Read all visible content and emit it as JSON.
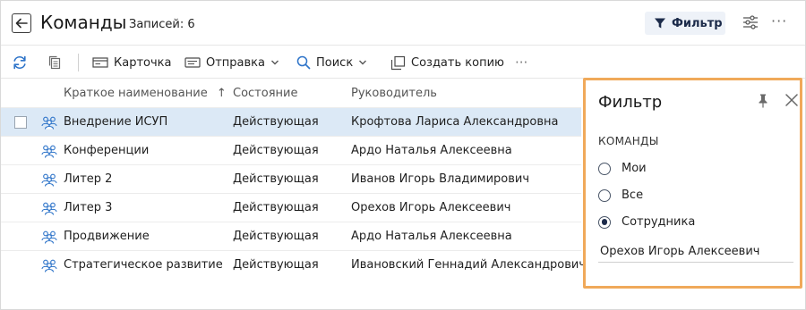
{
  "header": {
    "title": "Команды",
    "records_label": "Записей: 6",
    "filter_button": "Фильтр"
  },
  "toolbar": {
    "card": "Карточка",
    "send": "Отправка",
    "search": "Поиск",
    "create_copy": "Создать копию"
  },
  "table": {
    "columns": [
      "Краткое наименование",
      "Состояние",
      "Руководитель"
    ],
    "sort_indicator": "↑",
    "rows": [
      {
        "name": "Внедрение ИСУП",
        "state": "Действующая",
        "head": "Крофтова Лариса Александровна",
        "selected": true
      },
      {
        "name": "Конференции",
        "state": "Действующая",
        "head": "Ардо Наталья Алексеевна"
      },
      {
        "name": "Литер 2",
        "state": "Действующая",
        "head": "Иванов Игорь Владимирович"
      },
      {
        "name": "Литер 3",
        "state": "Действующая",
        "head": "Орехов Игорь Алексеевич"
      },
      {
        "name": "Продвижение",
        "state": "Действующая",
        "head": "Ардо Наталья Алексеевна"
      },
      {
        "name": "Стратегическое развитие",
        "state": "Действующая",
        "head": "Ивановский Геннадий Александрович"
      }
    ]
  },
  "filter_panel": {
    "title": "Фильтр",
    "section": "КОМАНДЫ",
    "options": [
      "Мои",
      "Все",
      "Сотрудника"
    ],
    "selected_option": "Сотрудника",
    "employee_value": "Орехов Игорь Алексеевич"
  },
  "colors": {
    "accent": "#1c2b4a",
    "selection": "#dce9f6",
    "highlight_border": "#f0a95a",
    "icon_blue": "#2e74c9"
  }
}
